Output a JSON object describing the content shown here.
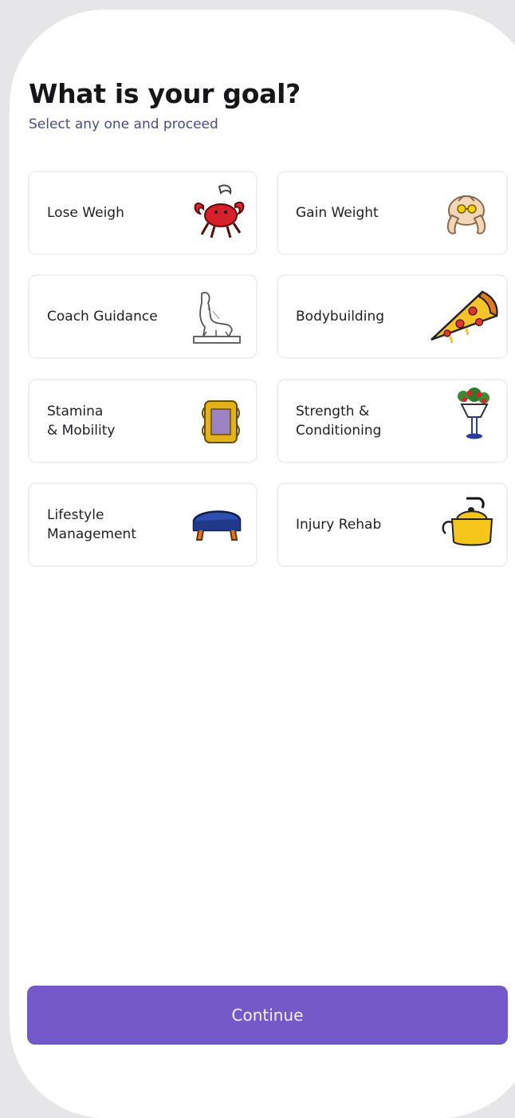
{
  "header": {
    "title": "What is your goal?",
    "subtitle": "Select any one and proceed"
  },
  "goals": [
    {
      "label": "Lose Weigh",
      "icon": "lobster-icon"
    },
    {
      "label": "Gain Weight",
      "icon": "roast-chicken-icon"
    },
    {
      "label": "Coach Guidance",
      "icon": "greyhound-statue-icon"
    },
    {
      "label": "Bodybuilding",
      "icon": "pizza-slice-icon"
    },
    {
      "label": "Stamina\n& Mobility",
      "icon": "picture-frame-icon"
    },
    {
      "label": "Strength &\nConditioning",
      "icon": "flower-vase-icon"
    },
    {
      "label": "Lifestyle\nManagement",
      "icon": "ottoman-icon"
    },
    {
      "label": "Injury Rehab",
      "icon": "teapot-icon"
    }
  ],
  "footer": {
    "continue_label": "Continue"
  },
  "colors": {
    "accent": "#7459c8",
    "subtitle": "#4a4d83",
    "title": "#16161a",
    "card_border": "#f0f0f2",
    "background": "#e6e6e8"
  }
}
